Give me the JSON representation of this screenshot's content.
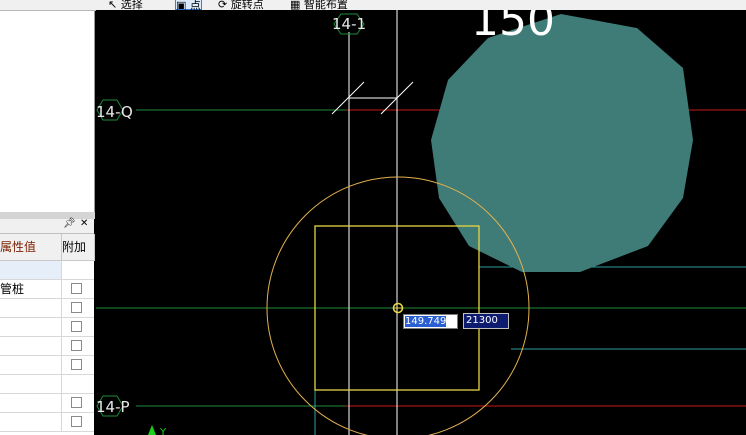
{
  "toolbar": {
    "select_label": "选择",
    "point_label": "点",
    "rotate_point_label": "旋转点",
    "smart_layout_label": "智能布置"
  },
  "property_panel": {
    "col_value": "属性值",
    "col_attach": "附加",
    "rows": [
      "",
      "管桩",
      "",
      "",
      "",
      "",
      "",
      "",
      ""
    ]
  },
  "drawing": {
    "axis_labels": [
      "14-1",
      "14-Q",
      "14-P"
    ],
    "big_number": "150",
    "dim_input_1": "149.749",
    "dim_input_2": "21300"
  },
  "colors": {
    "background": "#000000",
    "axis_line": "#ffffff",
    "grid_red": "#c81818",
    "grid_green": "#1f8a3a",
    "grid_cyan": "#2fa0a0",
    "pile_fill": "#3f7b77",
    "yellow": "#e8d640",
    "orange_circle": "#e2b250"
  }
}
